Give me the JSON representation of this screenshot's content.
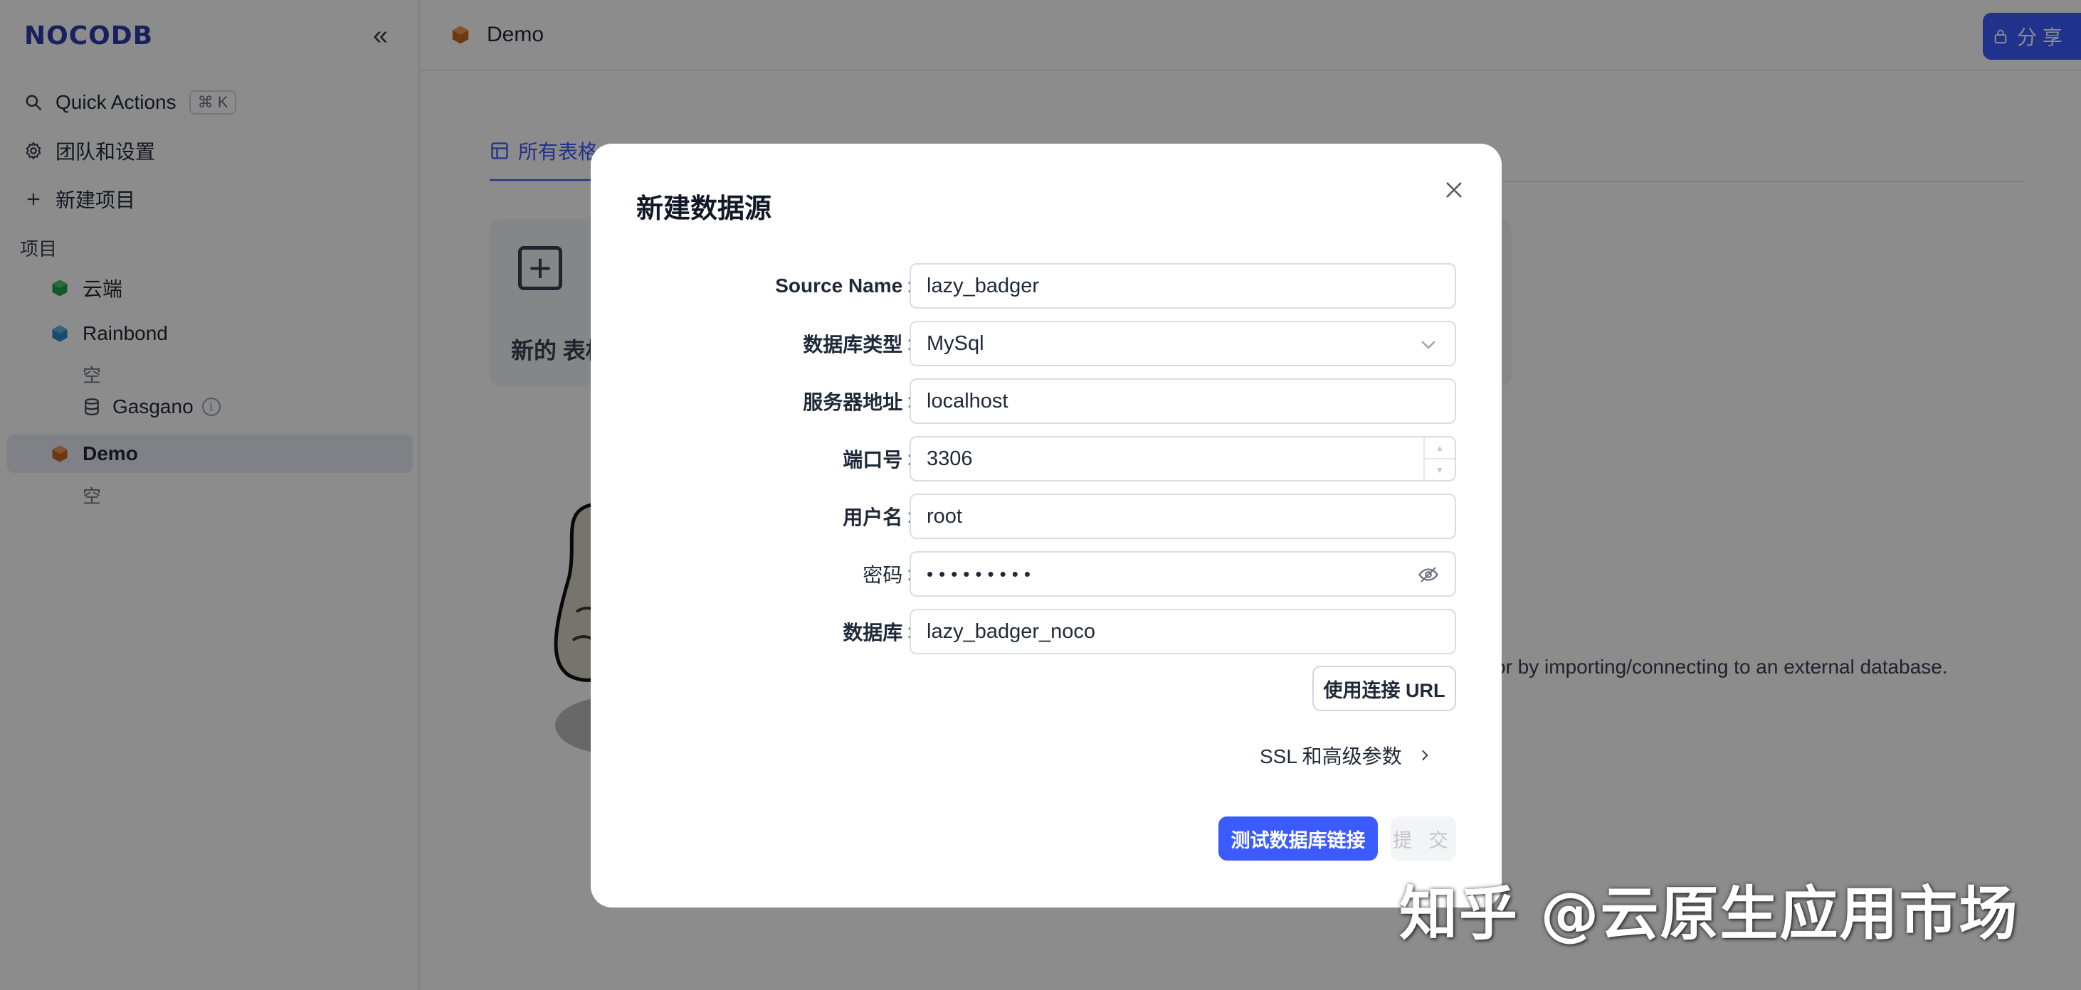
{
  "app": {
    "logo": "NOCODB",
    "accent": "#3b5bff"
  },
  "sidebar": {
    "quick_actions": "Quick Actions",
    "shortcut": "⌘ K",
    "team_settings": "团队和设置",
    "new_project": "新建项目",
    "section_label": "项目",
    "projects": [
      {
        "name": "云端",
        "color": "#22a04b"
      },
      {
        "name": "Rainbond",
        "color": "#2b8cc4"
      },
      {
        "name": "Demo",
        "color": "#c8661e"
      }
    ],
    "empty_label": "空",
    "datasource": "Gasgano"
  },
  "topbar": {
    "project_title": "Demo",
    "share_label": "分 享"
  },
  "tabs": [
    {
      "label": "所有表格",
      "active": true
    }
  ],
  "main": {
    "new_table_label": "新的 表格",
    "import_text": "or by importing/connecting to an external database."
  },
  "modal": {
    "title": "新建数据源",
    "fields": {
      "source_name": {
        "label": "Source Name",
        "value": "lazy_badger"
      },
      "db_type": {
        "label": "数据库类型",
        "value": "MySql"
      },
      "host": {
        "label": "服务器地址",
        "value": "localhost"
      },
      "port": {
        "label": "端口号",
        "value": "3306"
      },
      "username": {
        "label": "用户名",
        "value": "root"
      },
      "password": {
        "label": "密码",
        "value": "•••••••••"
      },
      "database": {
        "label": "数据库",
        "value": "lazy_badger_noco"
      }
    },
    "colon": ":",
    "use_url_button": "使用连接 URL",
    "ssl_link": "SSL 和高级参数",
    "test_button": "测试数据库链接",
    "submit_button": "提 交"
  },
  "watermark": "知乎 @云原生应用市场"
}
